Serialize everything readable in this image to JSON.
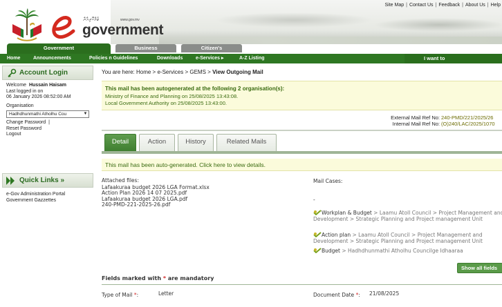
{
  "header": {
    "top_links": [
      "Site Map",
      "Contact Us",
      "Feedback",
      "About Us",
      "Help"
    ],
    "logo_dhivehi": "ޖުމްހޫރިއްޔާ",
    "logo_url": "www.gov.mv",
    "logo_word": "government",
    "tabs": [
      {
        "label": "Government",
        "active": true
      },
      {
        "label": "Business",
        "active": false
      },
      {
        "label": "Citizen's",
        "active": false
      }
    ]
  },
  "nav": {
    "items": [
      "Home",
      "Announcements",
      "Policies n Guidelines",
      "Downloads",
      "e-Services ▸",
      "A-Z Listing"
    ],
    "i_want_to": "I want to"
  },
  "login": {
    "title": "Account Login",
    "welcome_prefix": "Welcome",
    "user_name": "Hussain Haisam",
    "last_logged_label": "Last logged in on",
    "last_logged_value": "06 January 2026 08:52:00 AM",
    "organisation_label": "Organisation",
    "organisation_value": "Hadhdhunmathi Atholhu Cou",
    "change_password": "Change Password",
    "reset_password": "Reset Password",
    "logout": "Logout"
  },
  "quick_links": {
    "title": "Quick Links »",
    "items": [
      "e-Gov Administration Portal",
      "Government Gazzettes"
    ]
  },
  "breadcrumb": {
    "prefix": "You are here:",
    "items": [
      "Home",
      "e-Services",
      "GEMS"
    ],
    "current": "View Outgoing Mail"
  },
  "autogen": {
    "heading": "This mail has been autogenerated at the following 2 organisation(s):",
    "lines": [
      "Ministry of Finance and Planning on 25/08/2025 13:43:08.",
      "Local Government Authority on 25/08/2025 13:43:00."
    ]
  },
  "refs": {
    "external_label": "External Mail Ref No:",
    "external_value": "240-PMD/221/2025/26",
    "internal_label": "Internal Mail Ref No:",
    "internal_value": "(O)240/LAC/2025/1070"
  },
  "detail_tabs": [
    {
      "label": "Detail",
      "active": true
    },
    {
      "label": "Action",
      "active": false
    },
    {
      "label": "History",
      "active": false
    },
    {
      "label": "Related Mails",
      "active": false
    }
  ],
  "auto_generated_notice": "This mail has been auto-generated. Click here to view details.",
  "attached_files": {
    "title": "Attached files:",
    "files": [
      "Lafaakuraa budget 2026 LGA Format.xlsx",
      "Action Plan 2026 14 07 2025.pdf",
      "Lafaakuraa budget 2026 LGA.pdf",
      "240-PMD-221-2025-26.pdf"
    ]
  },
  "mail_cases": {
    "title": "Mail Cases:",
    "empty_marker": "-",
    "cases": [
      {
        "lead": "Workplan & Budget",
        "path": " > Laamu Atoll Council > Project Management and Development > Strategic Planning and Project management Unit"
      },
      {
        "lead": "Action plan",
        "path": " > Laamu Atoll Council > Project Management and Development > Strategic Planning and Project management Unit"
      },
      {
        "lead": "Budget",
        "path": " > Hadhdhunmathi Atholhu Councilge Idhaaraa"
      }
    ]
  },
  "show_all_fields": "Show all fields",
  "mandatory_note": {
    "prefix": "Fields marked with",
    "star": "*",
    "suffix": "are mandatory"
  },
  "fields": {
    "type_of_mail_label": "Type of Mail",
    "type_of_mail_value": "Letter",
    "document_date_label": "Document Date",
    "document_date_value": "21/08/2025"
  },
  "colors": {
    "nav_green": "#2e7722",
    "notice_yellow": "#fbfbdb",
    "notice_text": "#3a6b10",
    "tab_active": "#4a8a3a"
  }
}
